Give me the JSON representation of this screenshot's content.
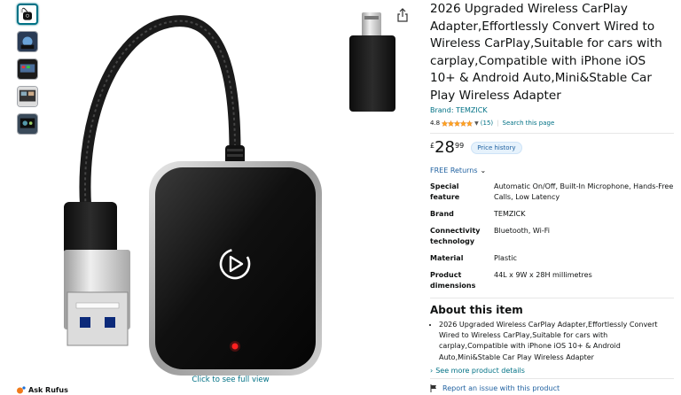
{
  "product": {
    "title": "2026 Upgraded Wireless CarPlay Adapter,Effortlessly Convert Wired to Wireless CarPlay,Suitable for cars with carplay,Compatible with iPhone iOS 10+ & Android Auto,Mini&Stable Car Play Wireless Adapter",
    "brand_link": "Brand: TEMZICK",
    "rating": "4.8",
    "rating_stars": 4.8,
    "rating_count": "(15)",
    "separator": "|",
    "search_page": "Search this page",
    "price_symbol": "£",
    "price_whole": "28",
    "price_fraction": "99",
    "price_history": "Price history",
    "returns": "FREE Returns",
    "see_full_view": "Click to see full view"
  },
  "specs": [
    {
      "key": "Special feature",
      "value": "Automatic On/Off, Built-In Microphone, Hands-Free Calls, Low Latency"
    },
    {
      "key": "Brand",
      "value": "TEMZICK"
    },
    {
      "key": "Connectivity technology",
      "value": "Bluetooth, Wi-Fi"
    },
    {
      "key": "Material",
      "value": "Plastic"
    },
    {
      "key": "Product dimensions",
      "value": "44L x 9W x 28H millimetres"
    }
  ],
  "about": {
    "title": "About this item",
    "bullets": [
      "2026 Upgraded Wireless CarPlay Adapter,Effortlessly Convert Wired to Wireless CarPlay,Suitable for cars with carplay,Compatible with iPhone iOS 10+ & Android Auto,Mini&Stable Car Play Wireless Adapter"
    ],
    "see_more": "See more product details",
    "report": "Report an issue with this product"
  },
  "rufus": {
    "label": "Ask Rufus"
  },
  "colors": {
    "link": "#007185",
    "star": "#ffa41c",
    "accent": "#f3a847"
  }
}
